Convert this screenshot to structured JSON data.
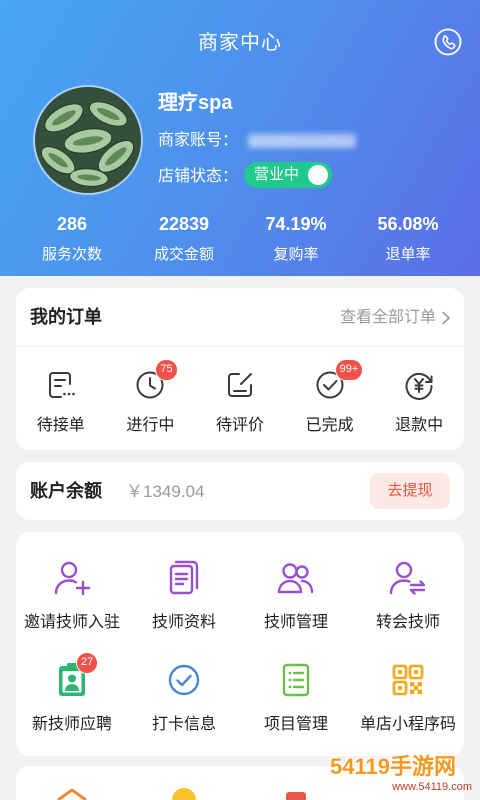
{
  "header": {
    "title": "商家中心",
    "phone_icon": "phone-icon"
  },
  "profile": {
    "name": "理疗spa",
    "account_label": "商家账号：",
    "status_label": "店铺状态：",
    "status_toggle": "营业中",
    "status_on": true
  },
  "stats": [
    {
      "value": "286",
      "label": "服务次数"
    },
    {
      "value": "22839",
      "label": "成交金额"
    },
    {
      "value": "74.19%",
      "label": "复购率"
    },
    {
      "value": "56.08%",
      "label": "退单率"
    }
  ],
  "orders": {
    "title": "我的订单",
    "view_all": "查看全部订单",
    "items": [
      {
        "label": "待接单",
        "icon": "pending-order-icon"
      },
      {
        "label": "进行中",
        "icon": "clock-icon",
        "badge": "75"
      },
      {
        "label": "待评价",
        "icon": "edit-icon"
      },
      {
        "label": "已完成",
        "icon": "check-circle-icon",
        "badge": "99+"
      },
      {
        "label": "退款中",
        "icon": "yuan-refund-icon"
      }
    ]
  },
  "balance": {
    "title": "账户余额",
    "amount": "￥1349.04",
    "withdraw_label": "去提现"
  },
  "services": {
    "items": [
      {
        "label": "邀请技师入驻",
        "icon": "user-plus-icon"
      },
      {
        "label": "技师资料",
        "icon": "document-icon"
      },
      {
        "label": "技师管理",
        "icon": "users-icon"
      },
      {
        "label": "转会技师",
        "icon": "user-transfer-icon"
      },
      {
        "label": "新技师应聘",
        "icon": "id-badge-icon",
        "badge": "27"
      },
      {
        "label": "打卡信息",
        "icon": "check-circle-icon"
      },
      {
        "label": "项目管理",
        "icon": "list-icon"
      },
      {
        "label": "单店小程序码",
        "icon": "qr-code-icon"
      }
    ]
  },
  "more_services": {
    "icons": [
      "house-icon",
      "circle-icon",
      "box-icon"
    ]
  },
  "watermark": {
    "brand": "54119手游网",
    "url": "www.54119.com"
  },
  "colors": {
    "header_start": "#46a6f2",
    "header_end": "#5b6fe6",
    "status_green": "#22c98c",
    "badge_red": "#f0524a",
    "withdraw_text": "#e3533f",
    "withdraw_bg": "#fce9e6",
    "icon_purple": "#9a4fd1",
    "icon_green": "#2bb673",
    "icon_blue": "#4b86d4",
    "icon_lime": "#6cc04a",
    "icon_orange": "#f3a91b"
  }
}
